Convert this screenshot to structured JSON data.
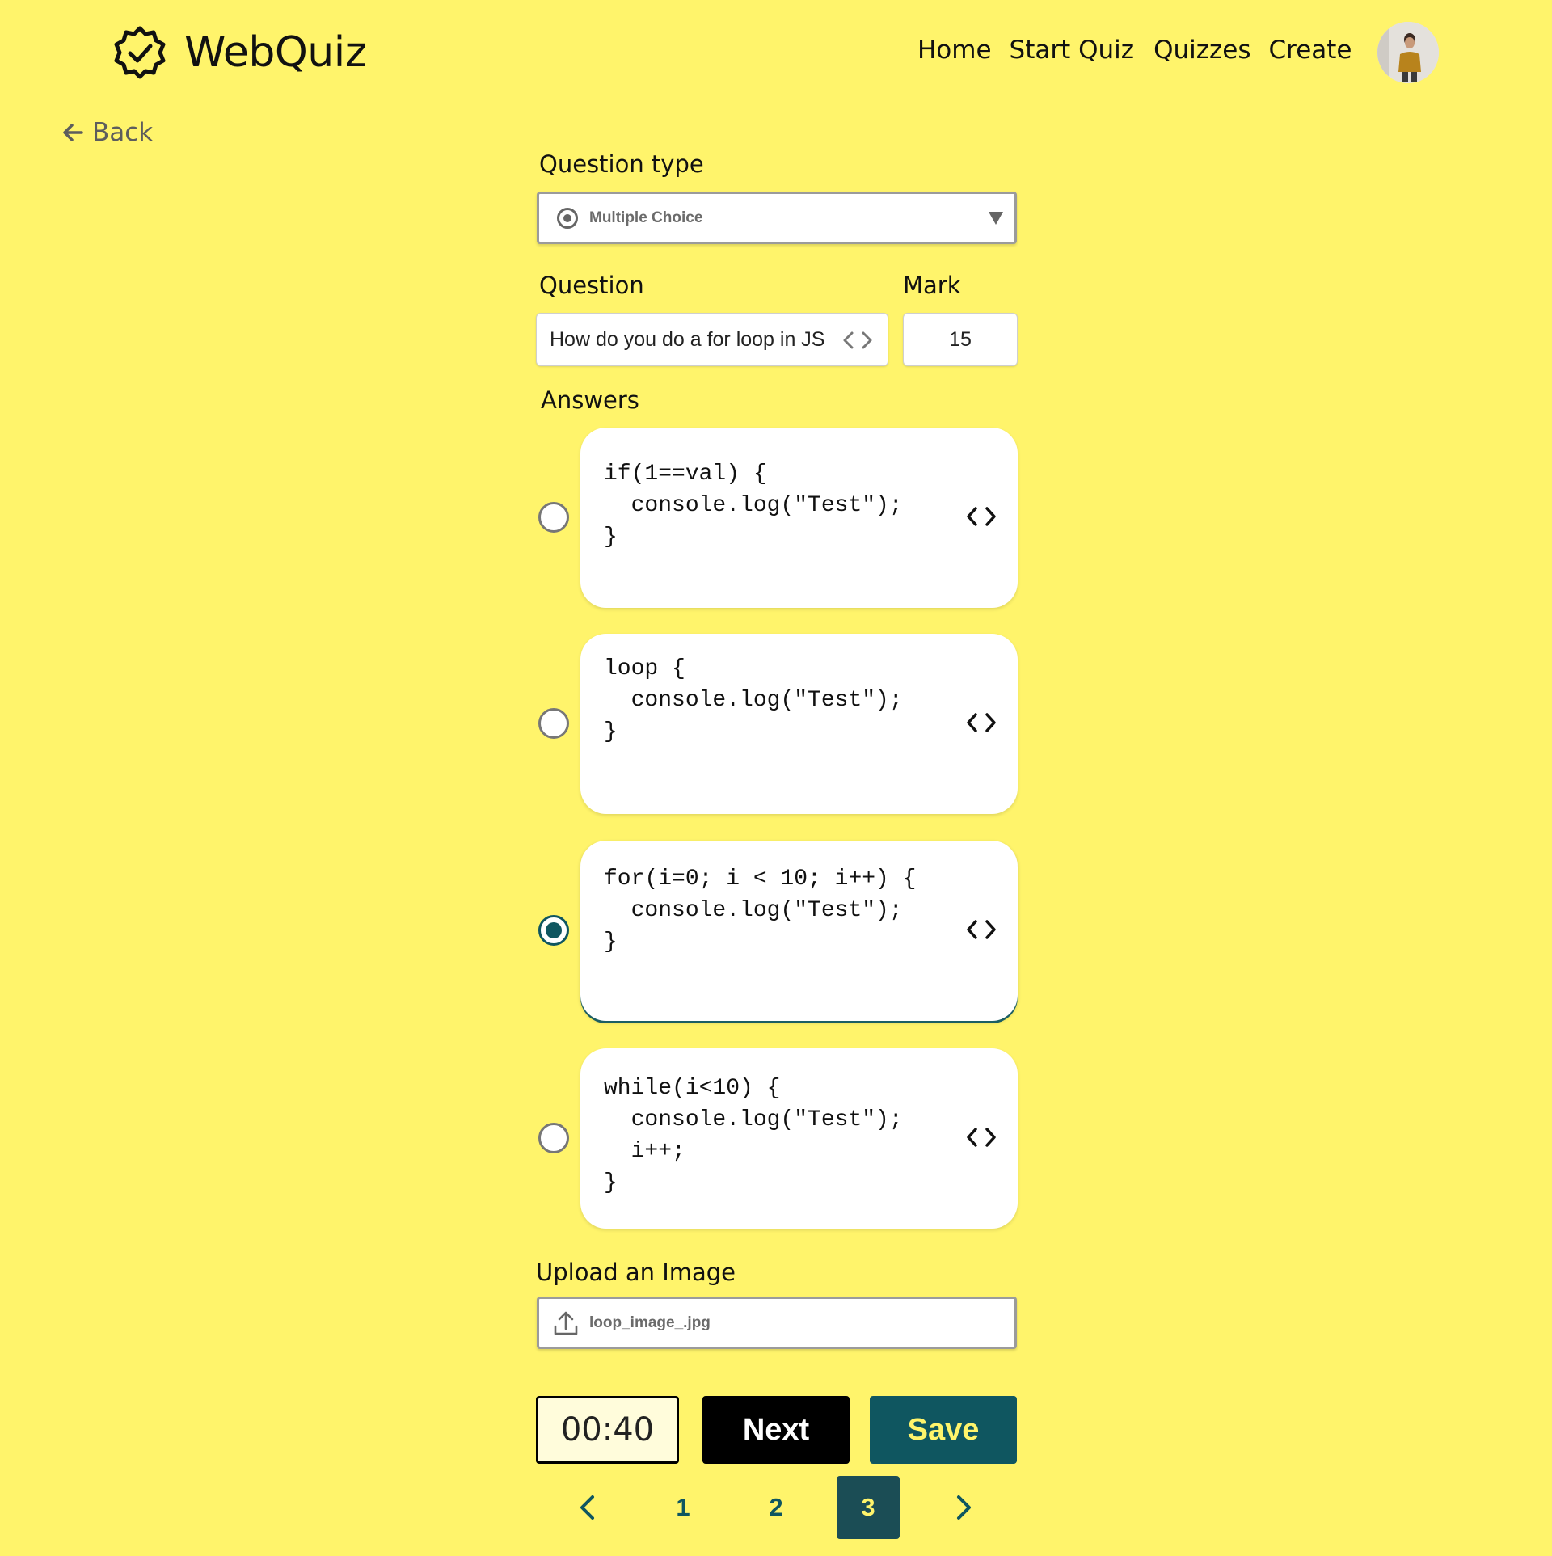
{
  "header": {
    "app_name": "WebQuiz",
    "nav": [
      "Home",
      "Start Quiz",
      "Quizzes",
      "Create"
    ]
  },
  "back_label": "Back",
  "form": {
    "question_type_label": "Question type",
    "question_type_value": "Multiple Choice",
    "question_label": "Question",
    "question_value": "How do you do a for loop in JS",
    "mark_label": "Mark",
    "mark_value": "15",
    "answers_label": "Answers",
    "answers": [
      {
        "code": "if(1==val) {\n  console.log(\"Test\");\n}",
        "selected": false
      },
      {
        "code": "loop {\n  console.log(\"Test\");\n}",
        "selected": false
      },
      {
        "code": "for(i=0; i < 10; i++) {\n  console.log(\"Test\");\n}",
        "selected": true
      },
      {
        "code": "while(i<10) {\n  console.log(\"Test\");\n  i++;\n}",
        "selected": false
      }
    ],
    "upload_label": "Upload an Image",
    "upload_file": "loop_image_.jpg"
  },
  "footer": {
    "timer": "00:40",
    "next_label": "Next",
    "save_label": "Save"
  },
  "pagination": {
    "pages": [
      "1",
      "2",
      "3"
    ],
    "current": "3"
  },
  "colors": {
    "background": "#fff46b",
    "accent": "#0f5660",
    "card": "#ffffff"
  },
  "icons": [
    "logo-badge-check-icon",
    "arrow-left-icon",
    "radio-icon",
    "caret-down-icon",
    "code-icon",
    "upload-icon",
    "chevron-left-icon",
    "chevron-right-icon"
  ]
}
